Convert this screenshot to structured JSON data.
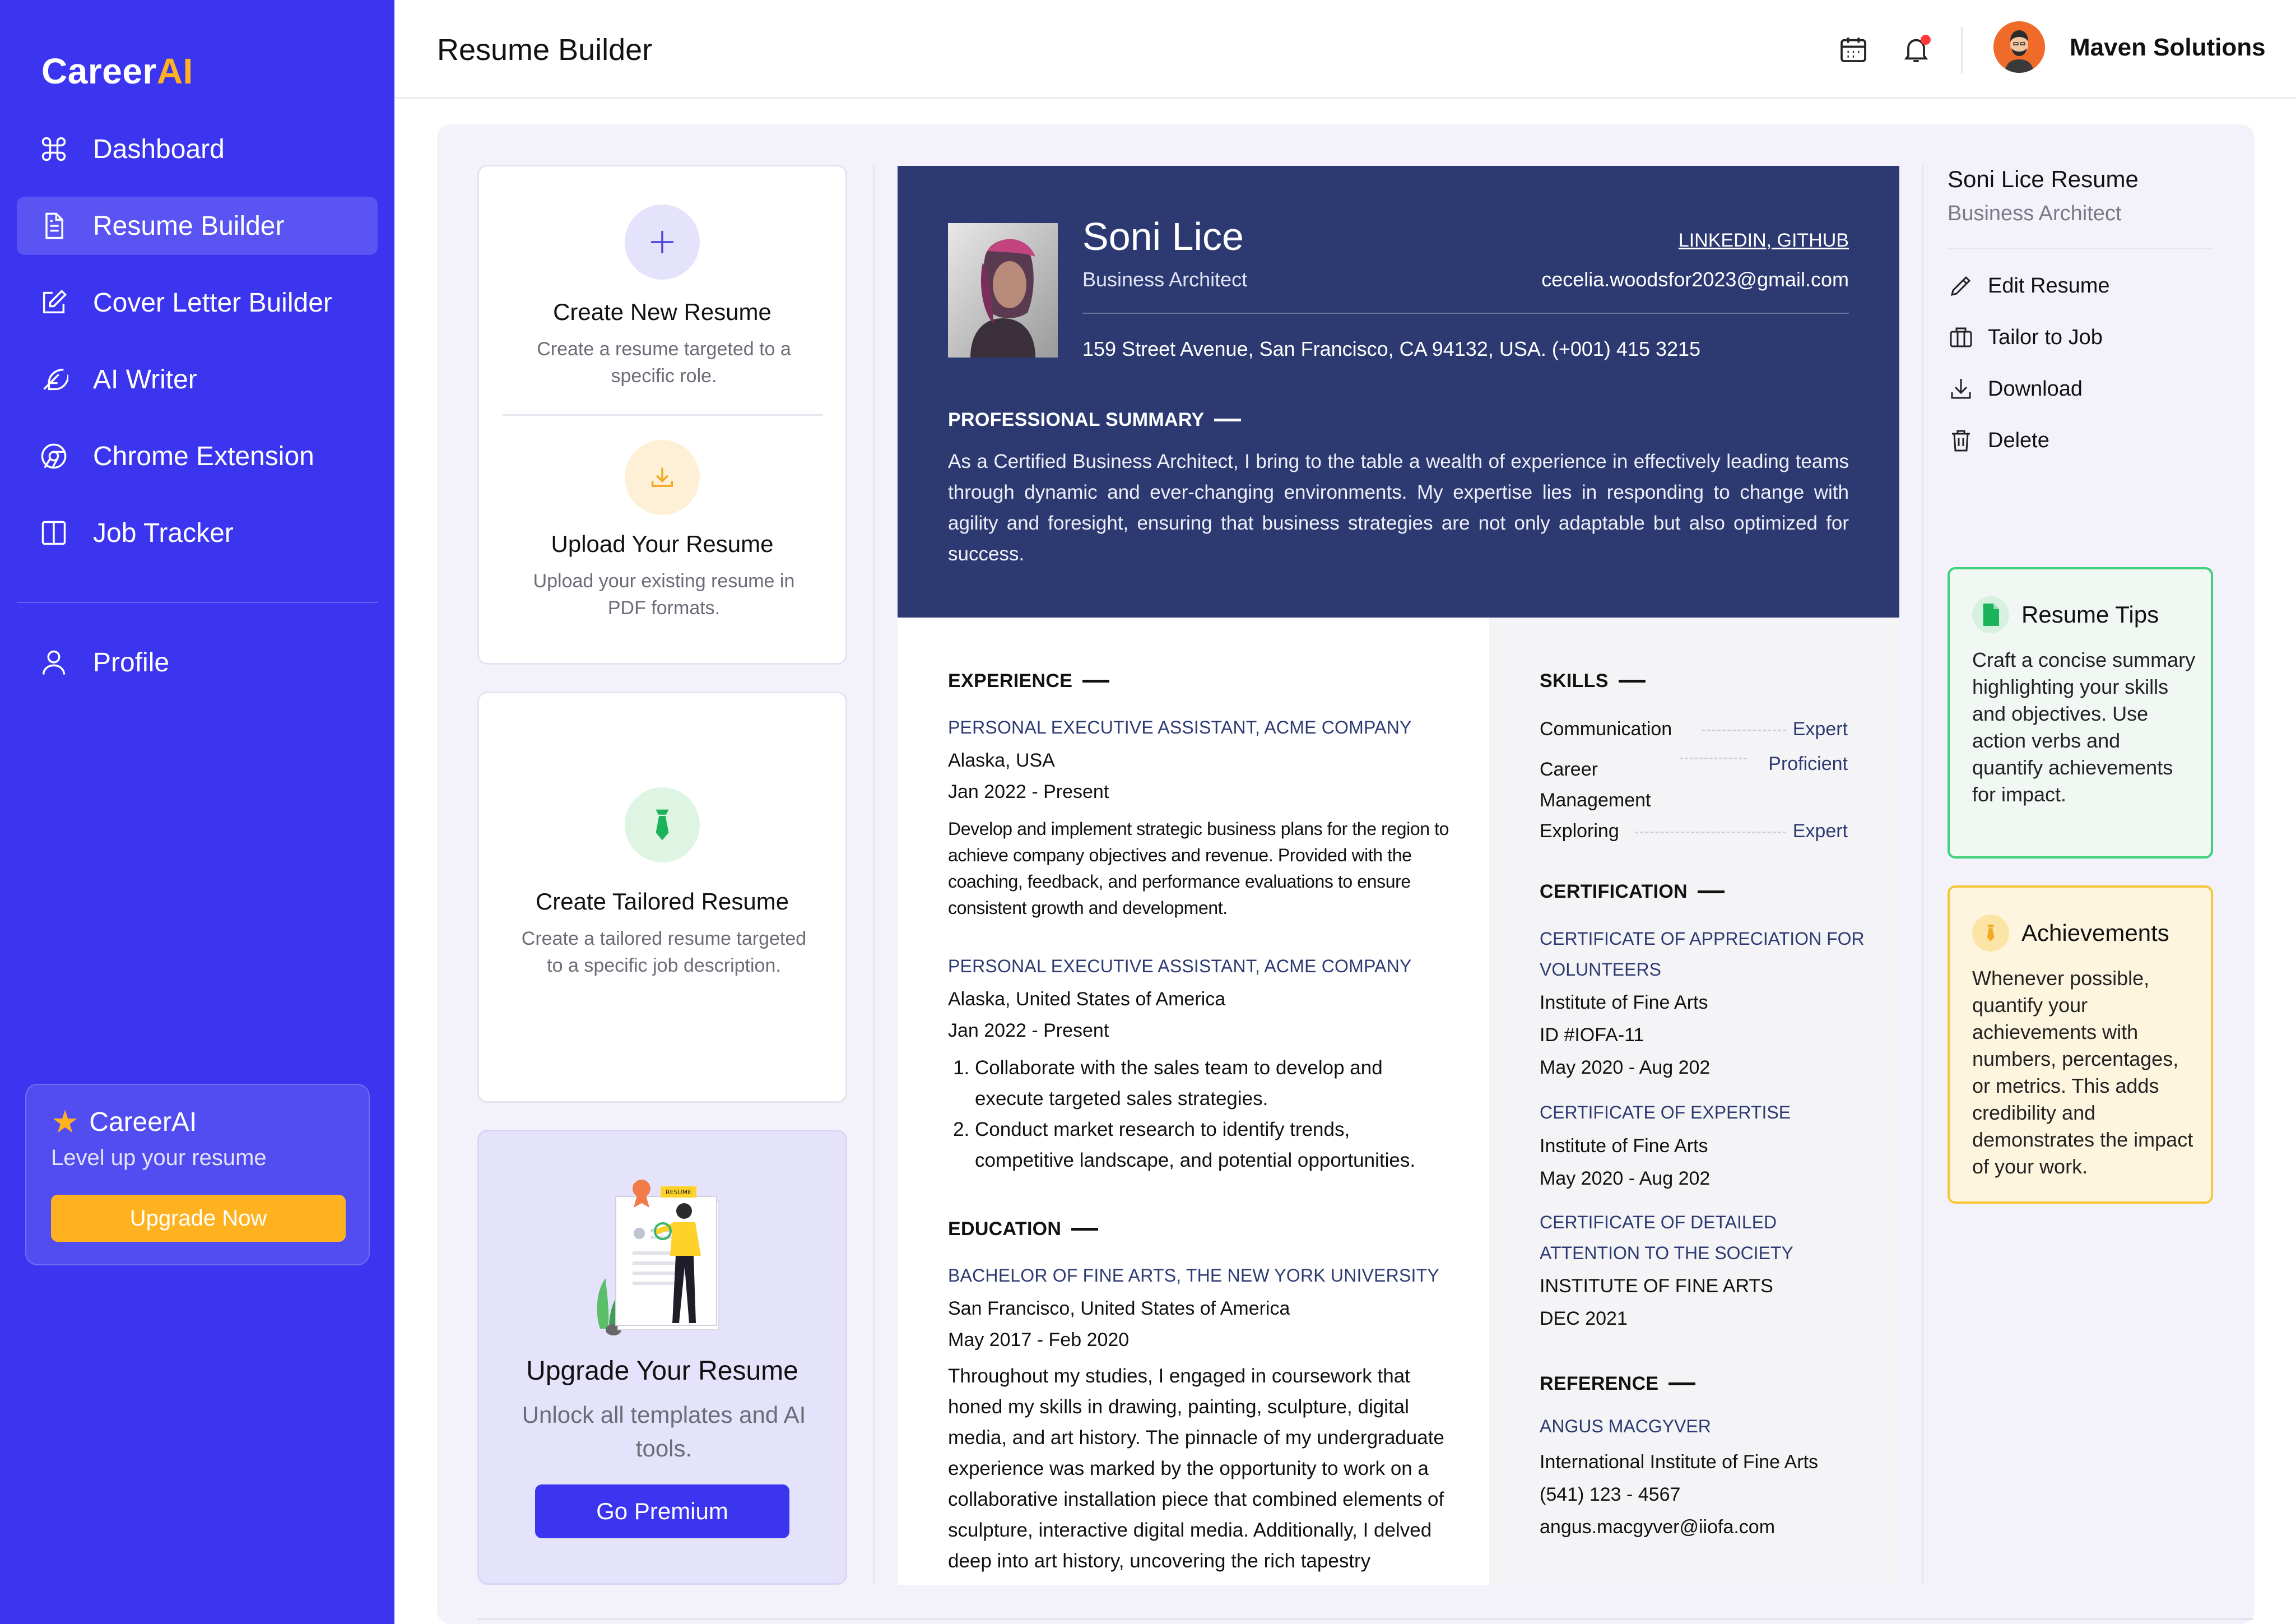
{
  "brand": {
    "name_main": "Career",
    "name_accent": "AI"
  },
  "sidebar": {
    "items": [
      {
        "label": "Dashboard",
        "icon": "command-icon"
      },
      {
        "label": "Resume Builder",
        "icon": "document-icon",
        "active": true
      },
      {
        "label": "Cover Letter Builder",
        "icon": "edit-icon"
      },
      {
        "label": "AI Writer",
        "icon": "feather-icon"
      },
      {
        "label": "Chrome Extension",
        "icon": "chrome-icon"
      },
      {
        "label": "Job Tracker",
        "icon": "columns-icon"
      }
    ],
    "profile_label": "Profile",
    "promo": {
      "title": "CareerAI",
      "subtitle": "Level up your resume",
      "button": "Upgrade Now"
    }
  },
  "header": {
    "title": "Resume Builder",
    "user_name": "Maven Solutions"
  },
  "options": {
    "create": {
      "title": "Create New Resume",
      "desc": "Create a resume targeted to a specific role."
    },
    "upload": {
      "title": "Upload Your Resume",
      "desc": "Upload your existing resume in PDF formats."
    },
    "tailored": {
      "title": "Create Tailored Resume",
      "desc": "Create a tailored resume targeted to a specific job description."
    },
    "upgrade": {
      "title": "Upgrade Your Resume",
      "desc": "Unlock all templates and AI tools.",
      "button": "Go Premium",
      "badge": "RESUME"
    }
  },
  "resume": {
    "name": "Soni Lice",
    "role": "Business Architect",
    "links": "LINKEDIN, GITHUB",
    "email": "cecelia.woodsfor2023@gmail.com",
    "address": "159 Street Avenue, San Francisco, CA 94132, USA. (+001) 415 3215",
    "summary_heading": "PROFESSIONAL SUMMARY",
    "summary": "As a Certified Business Architect, I bring to the table a wealth of experience in effectively leading teams through dynamic and ever-changing environments. My expertise lies in responding to change with agility and foresight, ensuring that business strategies are not only adaptable but also optimized for success.",
    "experience_heading": "EXPERIENCE",
    "jobs": [
      {
        "title": "PERSONAL EXECUTIVE ASSISTANT, ACME COMPANY",
        "location": "Alaska, USA",
        "dates": "Jan 2022 - Present",
        "desc": "Develop and implement strategic business plans for the region to achieve company objectives and revenue. Provided with the coaching, feedback, and performance evaluations to ensure consistent growth and development."
      },
      {
        "title": "PERSONAL EXECUTIVE ASSISTANT, ACME COMPANY",
        "location": "Alaska, United States of America",
        "dates": "Jan 2022 - Present",
        "bullets": [
          "Collaborate with the sales team to develop and execute targeted sales strategies.",
          "Conduct market research to identify trends, competitive landscape, and potential opportunities."
        ]
      }
    ],
    "education_heading": "EDUCATION",
    "education": {
      "title": "BACHELOR OF FINE ARTS, THE NEW YORK UNIVERSITY",
      "location": "San Francisco, United States of America",
      "dates": "May 2017 - Feb 2020",
      "desc": "Throughout my studies, I engaged in coursework that honed my skills in drawing, painting, sculpture, digital media, and art history. The pinnacle of my undergraduate experience was marked by the opportunity to work on a collaborative installation piece that combined elements of sculpture, interactive digital media. Additionally, I delved deep into art history, uncovering the rich tapestry"
    },
    "skills_heading": "SKILLS",
    "skills": [
      {
        "name": "Communication",
        "level": "Expert"
      },
      {
        "name": "Career Management",
        "level": "Proficient"
      },
      {
        "name": "Exploring",
        "level": "Expert"
      }
    ],
    "cert_heading": "CERTIFICATION",
    "certs": [
      {
        "title": "CERTIFICATE OF APPRECIATION FOR VOLUNTEERS",
        "lines": [
          "Institute of Fine Arts",
          "ID #IOFA-11",
          "May 2020 - Aug 202"
        ]
      },
      {
        "title": "CERTIFICATE OF EXPERTISE",
        "lines": [
          "Institute of Fine Arts",
          "May 2020 - Aug 202"
        ]
      },
      {
        "title": "CERTIFICATE OF DETAILED ATTENTION TO THE SOCIETY",
        "lines": [
          "INSTITUTE OF FINE ARTS",
          "DEC 2021"
        ]
      }
    ],
    "reference_heading": "REFERENCE",
    "reference": {
      "name": "ANGUS MACGYVER",
      "org": "International Institute of Fine Arts",
      "phone": "(541) 123 - 4567",
      "email": "angus.macgyver@iiofa.com"
    }
  },
  "panel": {
    "title": "Soni Lice Resume",
    "subtitle": "Business Architect",
    "actions": [
      "Edit Resume",
      "Tailor to Job",
      "Download",
      "Delete"
    ],
    "tips": {
      "title": "Resume Tips",
      "body": "Craft a concise summary highlighting your skills and objectives. Use action verbs and quantify achievements for impact."
    },
    "achievements": {
      "title": "Achievements",
      "body": "Whenever possible, quantify your achievements with numbers, percentages, or metrics. This adds credibility and demonstrates the impact of your work."
    }
  },
  "colors": {
    "sidebar": "#3b35f0",
    "accent": "#ffb21f",
    "resume_header": "#2d3a72",
    "tips_border": "#40d07a",
    "achievements_border": "#f6c53a"
  }
}
